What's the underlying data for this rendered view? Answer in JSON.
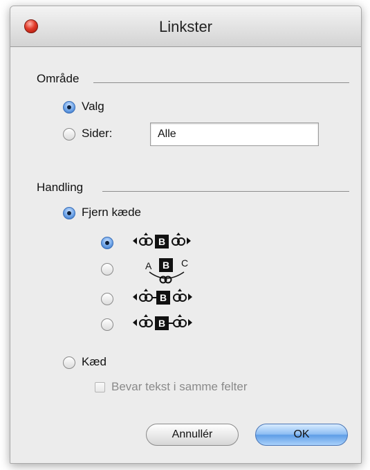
{
  "window": {
    "title": "Linkster"
  },
  "area": {
    "section_label": "Område",
    "selection_label": "Valg",
    "pages_label": "Sider:",
    "pages_value": "Alle"
  },
  "action": {
    "section_label": "Handling",
    "remove_chain_label": "Fjern kæde",
    "chain_label": "Kæd",
    "keep_text_label": "Bevar tekst i samme felter",
    "chain_options": [
      {
        "icon": "chain-both-sides-icon",
        "letters": [
          "",
          "B",
          ""
        ],
        "selected": true
      },
      {
        "icon": "chain-a-b-c-icon",
        "letters": [
          "A",
          "B",
          "C"
        ],
        "selected": false
      },
      {
        "icon": "chain-left-linked-icon",
        "letters": [
          "",
          "B",
          ""
        ],
        "selected": false
      },
      {
        "icon": "chain-right-linked-icon",
        "letters": [
          "",
          "B",
          ""
        ],
        "selected": false
      }
    ]
  },
  "buttons": {
    "cancel": "Annullér",
    "ok": "OK"
  },
  "colors": {
    "radio_selected": "#3a6fb8",
    "ok_button": "#5e9de6",
    "close_button": "#e23b2a"
  }
}
